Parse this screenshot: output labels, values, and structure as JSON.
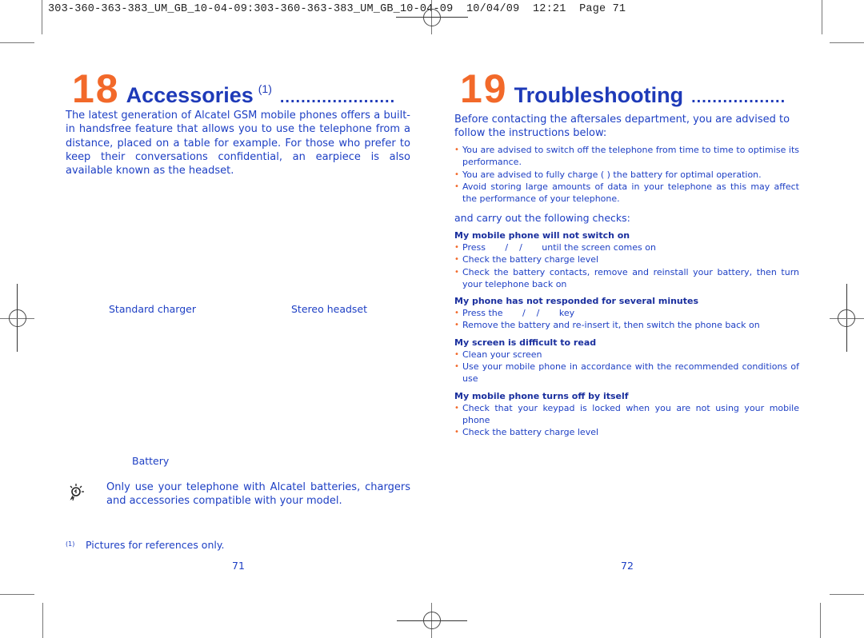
{
  "header": {
    "slug": "303-360-363-383_UM_GB_10-04-09:303-360-363-383_UM_GB_10-04-09  10/04/09  12:21  Page 71"
  },
  "left_page": {
    "chapter_number": "18",
    "chapter_title": "Accessories",
    "chapter_superscript": "(1)",
    "chapter_dots": "......................",
    "intro": "The latest generation of Alcatel GSM mobile phones offers a built-in handsfree feature that allows you to use the telephone from a distance, placed on a table for example. For those who prefer to keep their conversations confidential, an earpiece is also available known as the headset.",
    "captions": {
      "charger": "Standard charger",
      "headset": "Stereo headset",
      "battery": "Battery"
    },
    "tip_icon": "lightbulb-icon",
    "tip_text": "Only use your telephone with Alcatel batteries, chargers and accessories compatible with your model.",
    "footnote_marker": "(1)",
    "footnote_text": "Pictures for references only.",
    "page_number": "71"
  },
  "right_page": {
    "chapter_number": "19",
    "chapter_title": "Troubleshooting",
    "chapter_dots": "..................",
    "intro": "Before contacting the aftersales department, you are advised to follow the instructions below:",
    "advice": [
      "You are advised to switch off the telephone from time to time to optimise its performance.",
      "You are advised to fully charge (      ) the battery for optimal operation.",
      "Avoid storing large amounts of data in your telephone as this may affect the performance of your telephone."
    ],
    "checks_intro": "and carry out the following checks:",
    "sections": [
      {
        "heading": "My mobile phone will not switch on",
        "items": [
          "Press       /    /       until the screen comes on",
          "Check the battery charge level",
          "Check the battery contacts, remove and reinstall your battery, then turn your telephone back on"
        ]
      },
      {
        "heading": "My phone has not responded for several minutes",
        "items": [
          "Press the       /    /       key",
          "Remove the battery and re-insert it, then switch the phone back on"
        ]
      },
      {
        "heading": "My screen is difficult to read",
        "items": [
          "Clean your screen",
          "Use your mobile phone in accordance with the recommended conditions of use"
        ]
      },
      {
        "heading": "My mobile phone turns off by itself",
        "items": [
          "Check that your keypad is locked when you are not using your mobile phone",
          "Check the battery charge level"
        ]
      }
    ],
    "page_number": "72"
  },
  "colors": {
    "chapter_number": "#f2692a",
    "heading_blue": "#1e3ab8",
    "body_blue": "#1d3fc4",
    "bullet_orange": "#f2692a"
  }
}
